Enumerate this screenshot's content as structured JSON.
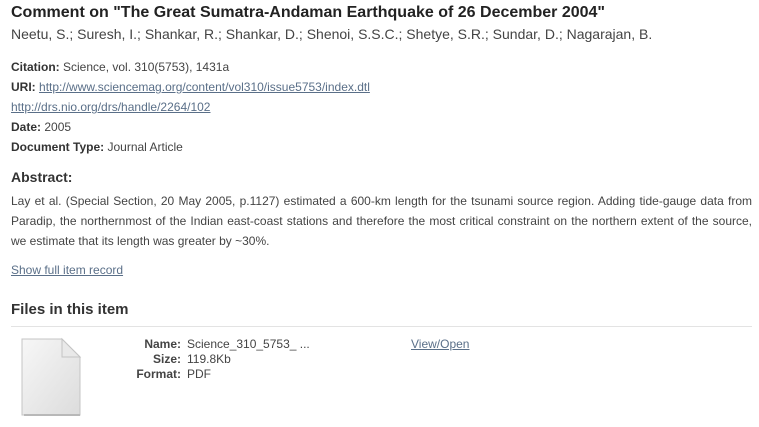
{
  "item": {
    "title": "Comment on \"The Great Sumatra-Andaman Earthquake of 26 December 2004\"",
    "authors": "Neetu, S.; Suresh, I.; Shankar, R.; Shankar, D.; Shenoi, S.S.C.; Shetye, S.R.; Sundar, D.; Nagarajan, B."
  },
  "metadata": {
    "citation_label": "Citation:",
    "citation_value": "Science, vol. 310(5753), 1431a",
    "uri_label": "URI:",
    "uri_1": "http://www.sciencemag.org/content/vol310/issue5753/index.dtl",
    "uri_2": "http://drs.nio.org/drs/handle/2264/102",
    "date_label": "Date:",
    "date_value": "2005",
    "doctype_label": "Document Type:",
    "doctype_value": "Journal Article"
  },
  "abstract": {
    "heading": "Abstract:",
    "text": "Lay et al. (Special Section, 20 May 2005, p.1127) estimated a 600-km length for the tsunami source region. Adding tide-gauge data from Paradip, the northernmost of the Indian east-coast stations and therefore the most critical constraint on the northern extent of the source, we estimate that its length was greater by ~30%."
  },
  "show_full_label": "Show full item record",
  "files": {
    "heading": "Files in this item",
    "name_label": "Name:",
    "name_value": "Science_310_5753_ ...",
    "size_label": "Size:",
    "size_value": "119.8Kb",
    "format_label": "Format:",
    "format_value": "PDF",
    "view_open_label": "View/Open",
    "icon": "file-icon"
  },
  "colors": {
    "link": "#5a6f88",
    "text": "#444444",
    "heading": "#222222"
  }
}
